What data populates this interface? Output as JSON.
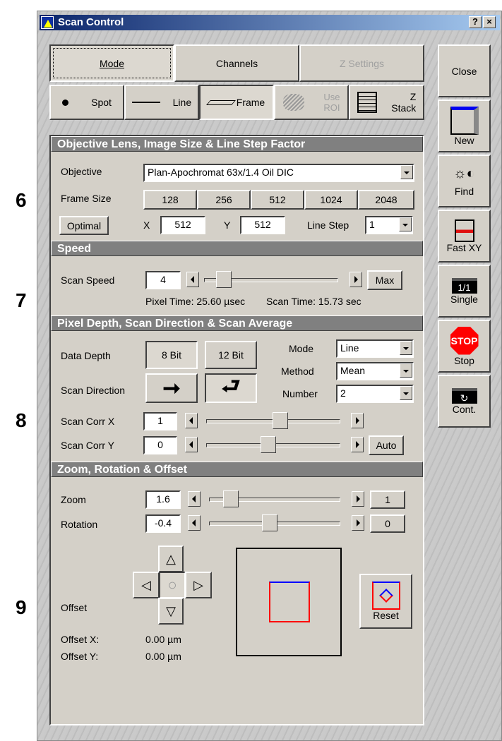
{
  "callouts": [
    "6",
    "7",
    "8",
    "9"
  ],
  "window": {
    "title": "Scan Control",
    "help": "?",
    "close": "×"
  },
  "tabs": [
    {
      "label": "Mode"
    },
    {
      "label": "Channels"
    },
    {
      "label": "Z Settings"
    }
  ],
  "scanmodes": [
    {
      "label": "Spot"
    },
    {
      "label": "Line"
    },
    {
      "label": "Frame"
    },
    {
      "label": "Use ROI"
    },
    {
      "label": "Z Stack"
    }
  ],
  "side": {
    "close": "Close",
    "new": "New",
    "find": "Find",
    "fastxy": "Fast XY",
    "single": "Single",
    "stop": "Stop",
    "cont": "Cont.",
    "stop_sign": "STOP",
    "single_icon": "1/1"
  },
  "objective": {
    "header": "Objective Lens, Image Size & Line Step Factor",
    "label": "Objective",
    "value": "Plan-Apochromat 63x/1.4 Oil DIC",
    "frame_label": "Frame Size",
    "frame_sizes": [
      "128",
      "256",
      "512",
      "1024",
      "2048"
    ],
    "optimal": "Optimal",
    "x_label": "X",
    "x": "512",
    "y_label": "Y",
    "y": "512",
    "linestep_label": "Line Step",
    "linestep": "1"
  },
  "speed": {
    "header": "Speed",
    "label": "Scan Speed",
    "value": "4",
    "slider": 0.1,
    "max": "Max",
    "pixel_time": "Pixel Time:  25.60 µsec",
    "scan_time": "Scan Time: 15.73 sec"
  },
  "depth": {
    "header": "Pixel Depth, Scan Direction & Scan Average",
    "data_depth": "Data Depth",
    "b8": "8 Bit",
    "b12": "12 Bit",
    "scan_dir": "Scan Direction",
    "mode_label": "Mode",
    "mode": "Line",
    "method_label": "Method",
    "method": "Mean",
    "number_label": "Number",
    "number": "2",
    "corrx_label": "Scan Corr X",
    "corrx": "1",
    "corrx_slider": 0.56,
    "corry_label": "Scan Corr Y",
    "corry": "0",
    "corry_slider": 0.46,
    "auto": "Auto"
  },
  "zoom": {
    "header": "Zoom, Rotation & Offset",
    "zoom_label": "Zoom",
    "zoom": "1.6",
    "zoom_slider": 0.12,
    "zoom_reset": "1",
    "rot_label": "Rotation",
    "rot": "-0.4",
    "rot_slider": 0.46,
    "rot_reset": "0",
    "offset_label": "Offset",
    "offx_label": "Offset X:",
    "offx": "0.00 µm",
    "offy_label": "Offset Y:",
    "offy": "0.00 µm",
    "reset": "Reset"
  }
}
